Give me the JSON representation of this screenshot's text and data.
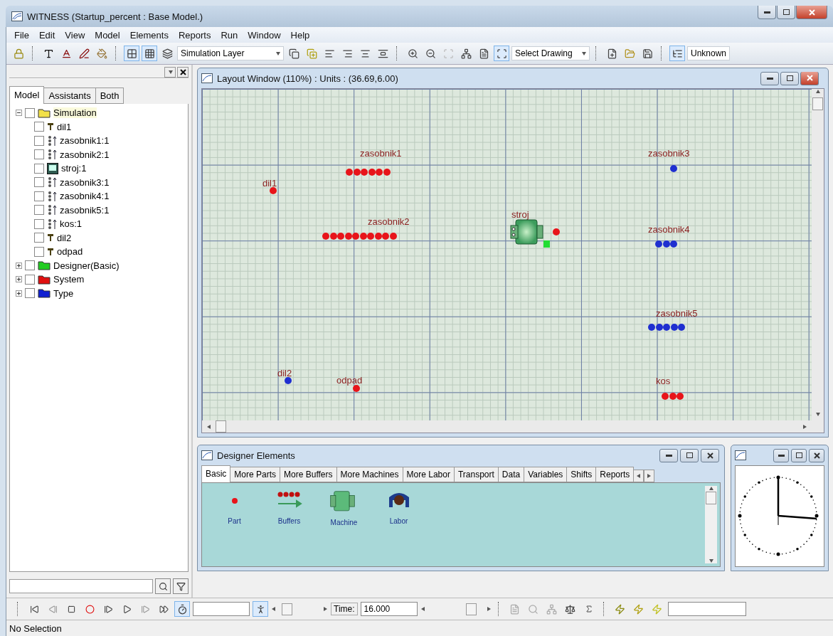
{
  "window": {
    "title": "WITNESS (Startup_percent : Base Model.)"
  },
  "menu": [
    "File",
    "Edit",
    "View",
    "Model",
    "Elements",
    "Reports",
    "Run",
    "Window",
    "Help"
  ],
  "toolbar": {
    "layer": "Simulation Layer",
    "drawing_mode": "Select Drawing",
    "status": "Unknown"
  },
  "explorer": {
    "tabs": [
      {
        "label": "Model",
        "selected": true
      },
      {
        "label": "Assistants",
        "selected": false
      },
      {
        "label": "Both",
        "selected": false
      }
    ],
    "tree": [
      {
        "label": "Simulation",
        "kind": "folder",
        "color": "#f2e04a",
        "expanded": true,
        "checked": false,
        "selected": true,
        "children": [
          {
            "label": "dil1",
            "kind": "part",
            "checked": false,
            "selected": false
          },
          {
            "label": "zasobnik1:1",
            "kind": "buffer",
            "checked": false,
            "selected": false
          },
          {
            "label": "zasobnik2:1",
            "kind": "buffer",
            "checked": false,
            "selected": false
          },
          {
            "label": "stroj:1",
            "kind": "machine",
            "checked": false,
            "selected": false
          },
          {
            "label": "zasobnik3:1",
            "kind": "buffer",
            "checked": false,
            "selected": false
          },
          {
            "label": "zasobnik4:1",
            "kind": "buffer",
            "checked": false,
            "selected": false
          },
          {
            "label": "zasobnik5:1",
            "kind": "buffer",
            "checked": false,
            "selected": false
          },
          {
            "label": "kos:1",
            "kind": "buffer",
            "checked": false,
            "selected": false
          },
          {
            "label": "dil2",
            "kind": "part",
            "checked": false,
            "selected": false
          },
          {
            "label": "odpad",
            "kind": "part",
            "checked": false,
            "selected": false
          }
        ]
      },
      {
        "label": "Designer(Basic)",
        "kind": "folder",
        "color": "#22cc22",
        "expanded": false,
        "checked": false,
        "selected": false
      },
      {
        "label": "System",
        "kind": "folder",
        "color": "#e01010",
        "expanded": false,
        "checked": false,
        "selected": false
      },
      {
        "label": "Type",
        "kind": "folder",
        "color": "#1020d0",
        "expanded": false,
        "checked": false,
        "selected": false
      }
    ]
  },
  "layout_window": {
    "title": "Layout Window (110%)  : Units : (36.69,6.00)",
    "elements": [
      {
        "label": "zasobnik1",
        "kind": "buffer",
        "parts": [
          {
            "color": "#e8141a"
          },
          {
            "color": "#e8141a"
          },
          {
            "color": "#e8141a"
          },
          {
            "color": "#e8141a"
          },
          {
            "color": "#e8141a"
          },
          {
            "color": "#e8141a"
          }
        ]
      },
      {
        "label": "dil1",
        "kind": "part",
        "color": "#e8141a"
      },
      {
        "label": "zasobnik2",
        "kind": "buffer",
        "parts": [
          {
            "color": "#e8141a"
          },
          {
            "color": "#e8141a"
          },
          {
            "color": "#e8141a"
          },
          {
            "color": "#e8141a"
          },
          {
            "color": "#e8141a"
          },
          {
            "color": "#e8141a"
          },
          {
            "color": "#e8141a"
          },
          {
            "color": "#e8141a"
          },
          {
            "color": "#e8141a"
          },
          {
            "color": "#e8141a"
          }
        ]
      },
      {
        "label": "stroj",
        "kind": "machine",
        "color": "#e8141a"
      },
      {
        "label": "zasobnik3",
        "kind": "buffer",
        "parts": [
          {
            "color": "#1f2fd0"
          }
        ]
      },
      {
        "label": "zasobnik4",
        "kind": "buffer",
        "parts": [
          {
            "color": "#1f2fd0"
          },
          {
            "color": "#1f2fd0"
          },
          {
            "color": "#1f2fd0"
          }
        ]
      },
      {
        "label": "zasobnik5",
        "kind": "buffer",
        "parts": [
          {
            "color": "#1f2fd0"
          },
          {
            "color": "#1f2fd0"
          },
          {
            "color": "#1f2fd0"
          },
          {
            "color": "#1f2fd0"
          },
          {
            "color": "#1f2fd0"
          }
        ]
      },
      {
        "label": "dil2",
        "kind": "part",
        "color": "#1f2fd0"
      },
      {
        "label": "odpad",
        "kind": "part",
        "color": "#e8141a"
      },
      {
        "label": "kos",
        "kind": "buffer",
        "parts": [
          {
            "color": "#e8141a"
          },
          {
            "color": "#e8141a"
          },
          {
            "color": "#e8141a"
          }
        ]
      }
    ]
  },
  "designer": {
    "title": "Designer Elements",
    "tabs": [
      {
        "label": "Basic",
        "selected": true
      },
      {
        "label": "More Parts",
        "selected": false
      },
      {
        "label": "More Buffers",
        "selected": false
      },
      {
        "label": "More Machines",
        "selected": false
      },
      {
        "label": "More Labor",
        "selected": false
      },
      {
        "label": "Transport",
        "selected": false
      },
      {
        "label": "Data",
        "selected": false
      },
      {
        "label": "Variables",
        "selected": false
      },
      {
        "label": "Shifts",
        "selected": false
      },
      {
        "label": "Reports",
        "selected": false
      }
    ],
    "items": [
      {
        "label": "Part",
        "kind": "part"
      },
      {
        "label": "Buffers",
        "kind": "buffer"
      },
      {
        "label": "Machine",
        "kind": "machine"
      },
      {
        "label": "Labor",
        "kind": "labor"
      }
    ]
  },
  "run_bar": {
    "speed_slider": {
      "level": 0.1
    },
    "time_label": "Time:",
    "time": "16.000",
    "time_slider": {
      "level": 0.85
    }
  },
  "status_bar": "No Selection"
}
